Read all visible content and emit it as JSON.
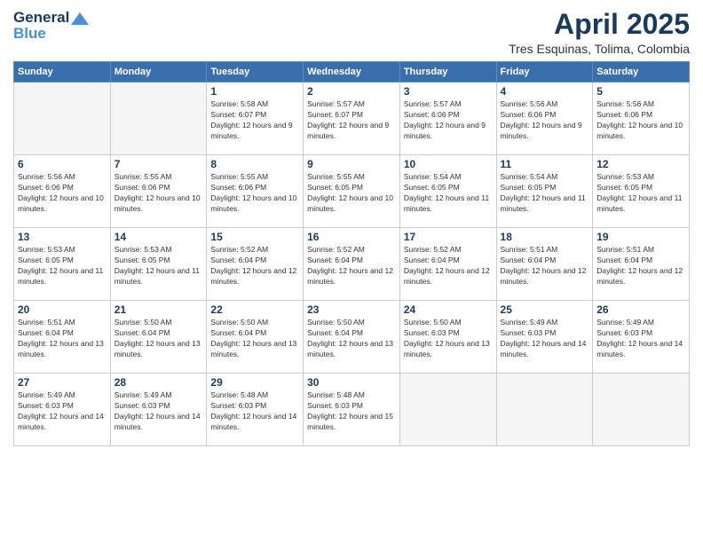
{
  "logo": {
    "line1": "General",
    "line2": "Blue"
  },
  "title": "April 2025",
  "location": "Tres Esquinas, Tolima, Colombia",
  "days_header": [
    "Sunday",
    "Monday",
    "Tuesday",
    "Wednesday",
    "Thursday",
    "Friday",
    "Saturday"
  ],
  "weeks": [
    [
      {
        "num": "",
        "info": ""
      },
      {
        "num": "",
        "info": ""
      },
      {
        "num": "1",
        "info": "Sunrise: 5:58 AM\nSunset: 6:07 PM\nDaylight: 12 hours and 9 minutes."
      },
      {
        "num": "2",
        "info": "Sunrise: 5:57 AM\nSunset: 6:07 PM\nDaylight: 12 hours and 9 minutes."
      },
      {
        "num": "3",
        "info": "Sunrise: 5:57 AM\nSunset: 6:06 PM\nDaylight: 12 hours and 9 minutes."
      },
      {
        "num": "4",
        "info": "Sunrise: 5:56 AM\nSunset: 6:06 PM\nDaylight: 12 hours and 9 minutes."
      },
      {
        "num": "5",
        "info": "Sunrise: 5:56 AM\nSunset: 6:06 PM\nDaylight: 12 hours and 10 minutes."
      }
    ],
    [
      {
        "num": "6",
        "info": "Sunrise: 5:56 AM\nSunset: 6:06 PM\nDaylight: 12 hours and 10 minutes."
      },
      {
        "num": "7",
        "info": "Sunrise: 5:55 AM\nSunset: 6:06 PM\nDaylight: 12 hours and 10 minutes."
      },
      {
        "num": "8",
        "info": "Sunrise: 5:55 AM\nSunset: 6:06 PM\nDaylight: 12 hours and 10 minutes."
      },
      {
        "num": "9",
        "info": "Sunrise: 5:55 AM\nSunset: 6:05 PM\nDaylight: 12 hours and 10 minutes."
      },
      {
        "num": "10",
        "info": "Sunrise: 5:54 AM\nSunset: 6:05 PM\nDaylight: 12 hours and 11 minutes."
      },
      {
        "num": "11",
        "info": "Sunrise: 5:54 AM\nSunset: 6:05 PM\nDaylight: 12 hours and 11 minutes."
      },
      {
        "num": "12",
        "info": "Sunrise: 5:53 AM\nSunset: 6:05 PM\nDaylight: 12 hours and 11 minutes."
      }
    ],
    [
      {
        "num": "13",
        "info": "Sunrise: 5:53 AM\nSunset: 6:05 PM\nDaylight: 12 hours and 11 minutes."
      },
      {
        "num": "14",
        "info": "Sunrise: 5:53 AM\nSunset: 6:05 PM\nDaylight: 12 hours and 11 minutes."
      },
      {
        "num": "15",
        "info": "Sunrise: 5:52 AM\nSunset: 6:04 PM\nDaylight: 12 hours and 12 minutes."
      },
      {
        "num": "16",
        "info": "Sunrise: 5:52 AM\nSunset: 6:04 PM\nDaylight: 12 hours and 12 minutes."
      },
      {
        "num": "17",
        "info": "Sunrise: 5:52 AM\nSunset: 6:04 PM\nDaylight: 12 hours and 12 minutes."
      },
      {
        "num": "18",
        "info": "Sunrise: 5:51 AM\nSunset: 6:04 PM\nDaylight: 12 hours and 12 minutes."
      },
      {
        "num": "19",
        "info": "Sunrise: 5:51 AM\nSunset: 6:04 PM\nDaylight: 12 hours and 12 minutes."
      }
    ],
    [
      {
        "num": "20",
        "info": "Sunrise: 5:51 AM\nSunset: 6:04 PM\nDaylight: 12 hours and 13 minutes."
      },
      {
        "num": "21",
        "info": "Sunrise: 5:50 AM\nSunset: 6:04 PM\nDaylight: 12 hours and 13 minutes."
      },
      {
        "num": "22",
        "info": "Sunrise: 5:50 AM\nSunset: 6:04 PM\nDaylight: 12 hours and 13 minutes."
      },
      {
        "num": "23",
        "info": "Sunrise: 5:50 AM\nSunset: 6:04 PM\nDaylight: 12 hours and 13 minutes."
      },
      {
        "num": "24",
        "info": "Sunrise: 5:50 AM\nSunset: 6:03 PM\nDaylight: 12 hours and 13 minutes."
      },
      {
        "num": "25",
        "info": "Sunrise: 5:49 AM\nSunset: 6:03 PM\nDaylight: 12 hours and 14 minutes."
      },
      {
        "num": "26",
        "info": "Sunrise: 5:49 AM\nSunset: 6:03 PM\nDaylight: 12 hours and 14 minutes."
      }
    ],
    [
      {
        "num": "27",
        "info": "Sunrise: 5:49 AM\nSunset: 6:03 PM\nDaylight: 12 hours and 14 minutes."
      },
      {
        "num": "28",
        "info": "Sunrise: 5:49 AM\nSunset: 6:03 PM\nDaylight: 12 hours and 14 minutes."
      },
      {
        "num": "29",
        "info": "Sunrise: 5:48 AM\nSunset: 6:03 PM\nDaylight: 12 hours and 14 minutes."
      },
      {
        "num": "30",
        "info": "Sunrise: 5:48 AM\nSunset: 6:03 PM\nDaylight: 12 hours and 15 minutes."
      },
      {
        "num": "",
        "info": ""
      },
      {
        "num": "",
        "info": ""
      },
      {
        "num": "",
        "info": ""
      }
    ]
  ]
}
